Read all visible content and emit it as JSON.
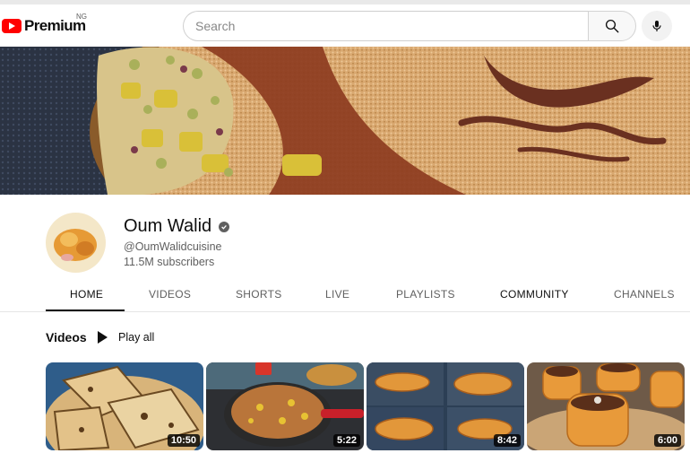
{
  "header": {
    "logo_text": "Premium",
    "country_code": "NG",
    "search_placeholder": "Search",
    "icons": [
      "youtube-logo-icon",
      "search-icon",
      "microphone-icon"
    ]
  },
  "channel": {
    "name": "Oum Walid",
    "handle": "@OumWalidcuisine",
    "subscribers": "11.5M subscribers",
    "verified": true
  },
  "tabs": [
    {
      "label": "HOME",
      "active": true
    },
    {
      "label": "VIDEOS",
      "active": false
    },
    {
      "label": "SHORTS",
      "active": false
    },
    {
      "label": "LIVE",
      "active": false
    },
    {
      "label": "PLAYLISTS",
      "active": false
    },
    {
      "label": "COMMUNITY",
      "active": false
    },
    {
      "label": "CHANNELS",
      "active": false
    }
  ],
  "videos_section": {
    "title": "Videos",
    "play_all_label": "Play all",
    "items": [
      {
        "duration": "10:50"
      },
      {
        "duration": "5:22"
      },
      {
        "duration": "8:42"
      },
      {
        "duration": "6:00"
      }
    ]
  },
  "colors": {
    "brand_red": "#ff0000",
    "text_primary": "#0f0f0f",
    "text_secondary": "#606060"
  }
}
